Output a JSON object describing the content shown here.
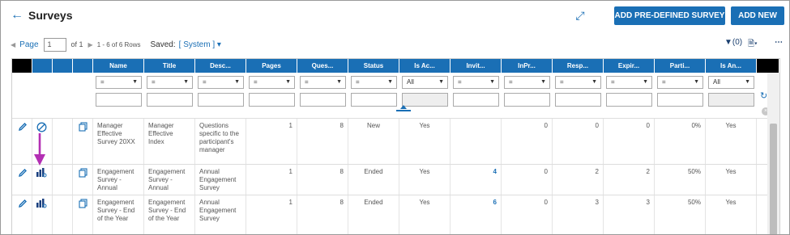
{
  "header": {
    "title": "Surveys",
    "add_predefined_label": "ADD PRE-DEFINED SURVEY",
    "add_new_label": "ADD NEW"
  },
  "pager": {
    "page_label": "Page",
    "page_value": "1",
    "of_label": "of 1",
    "rows_label": "1 - 6 of 6 Rows",
    "saved_label": "Saved:",
    "saved_value": "[ System ]"
  },
  "toolbar": {
    "filter_label": "(0)"
  },
  "columns": [
    "Name",
    "Title",
    "Desc...",
    "Pages",
    "Ques...",
    "Status",
    "Is Ac...",
    "Invit...",
    "InPr...",
    "Resp...",
    "Expir...",
    "Parti...",
    "Is An..."
  ],
  "filters": [
    "=",
    "=",
    "=",
    "=",
    "=",
    "=",
    "All",
    "=",
    "=",
    "=",
    "=",
    "=",
    "All"
  ],
  "rows": [
    {
      "name": "Manager Effective Survey 20XX",
      "title": "Manager Effective Index",
      "desc": "Questions specific to the participant's manager",
      "pages": "1",
      "questions": "8",
      "status": "New",
      "is_active": "Yes",
      "invited": "",
      "in_progress": "0",
      "responded": "0",
      "expired": "0",
      "participation": "0%",
      "is_anonymous": "Yes"
    },
    {
      "name": "Engagement Survey - Annual",
      "title": "Engagement Survey - Annual",
      "desc": "Annual Engagement Survey",
      "pages": "1",
      "questions": "8",
      "status": "Ended",
      "is_active": "Yes",
      "invited": "4",
      "in_progress": "0",
      "responded": "2",
      "expired": "2",
      "participation": "50%",
      "is_anonymous": "Yes"
    },
    {
      "name": "Engagement Survey - End of the Year",
      "title": "Engagement Survey - End of the Year",
      "desc": "Annual Engagement Survey",
      "pages": "1",
      "questions": "8",
      "status": "Ended",
      "is_active": "Yes",
      "invited": "6",
      "in_progress": "0",
      "responded": "3",
      "expired": "3",
      "participation": "50%",
      "is_anonymous": "Yes"
    }
  ],
  "colors": {
    "accent": "#1a6fb5",
    "annotation_arrow": "#b32fb3"
  }
}
